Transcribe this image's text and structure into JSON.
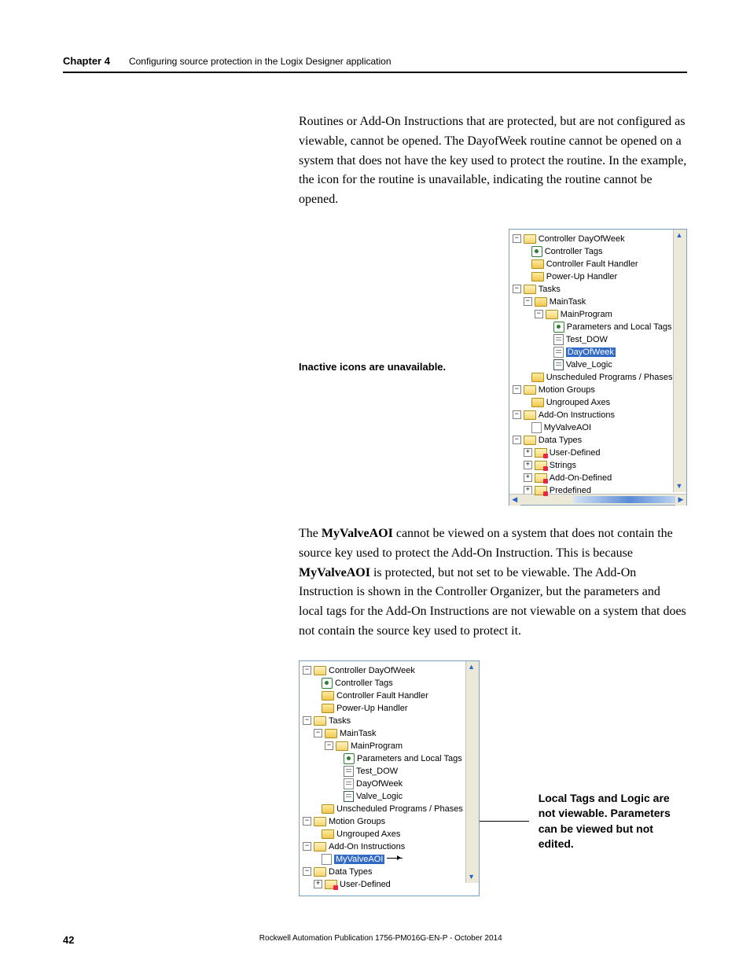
{
  "header": {
    "chapter": "Chapter 4",
    "title": "Configuring source protection in the Logix Designer application"
  },
  "para1_a": "Routines or Add-On Instructions that are protected, but are not configured as viewable, cannot be opened. The DayofWeek routine cannot be opened on a system that does not have the key used to protect the routine. In the example, the icon for the routine is unavailable, indicating the routine cannot be opened.",
  "callout1": "Inactive icons are unavailable.",
  "tree1": {
    "controller": "Controller DayOfWeek",
    "controller_tags": "Controller Tags",
    "fault_handler": "Controller Fault Handler",
    "powerup": "Power-Up Handler",
    "tasks": "Tasks",
    "maintask": "MainTask",
    "mainprog": "MainProgram",
    "params": "Parameters and Local Tags",
    "test_dow": "Test_DOW",
    "dayofweek": "DayOfWeek",
    "valve_logic": "Valve_Logic",
    "unsched": "Unscheduled Programs / Phases",
    "motion": "Motion Groups",
    "ungrouped": "Ungrouped Axes",
    "aoi": "Add-On Instructions",
    "myvalve": "MyValveAOI",
    "datatypes": "Data Types",
    "userdef": "User-Defined",
    "strings": "Strings",
    "aoidef": "Add-On-Defined",
    "predef": "Predefined"
  },
  "para2_pre": "The ",
  "para2_b1": "MyValveAOI",
  "para2_mid1": " cannot be viewed on a system that does not contain the source key used to protect the Add-On Instruction. This is because ",
  "para2_b2": "MyValveAOI",
  "para2_mid2": " is protected, but not set to be viewable. The Add-On Instruction is shown in the Controller Organizer, but the parameters and local tags for the Add-On Instructions are not viewable on a system that does not contain the source key used to protect it.",
  "callout2": "Local Tags and Logic are not viewable. Parameters can be viewed but not edited.",
  "footer": {
    "page": "42",
    "pubid": "Rockwell Automation Publication 1756-PM016G-EN-P - October 2014"
  }
}
